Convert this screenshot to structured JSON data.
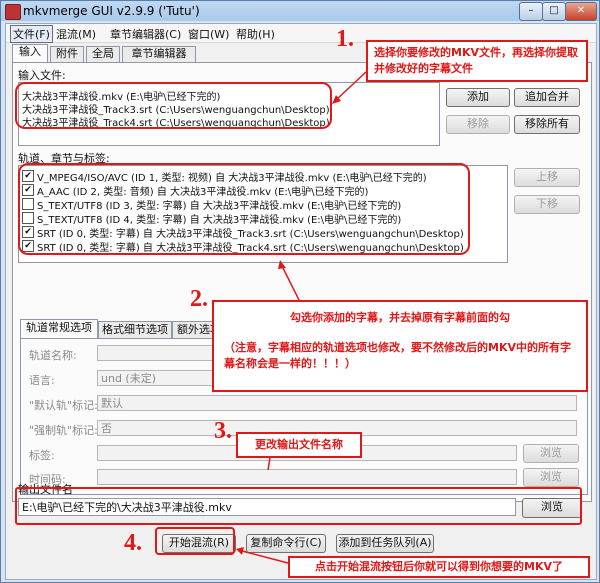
{
  "window": {
    "title": "mkvmerge GUI v2.9.9 ('Tutu')",
    "min": "–",
    "max": "□",
    "close": "✕"
  },
  "menu": [
    "文件(F)",
    "混流(M)",
    "章节编辑器(C)",
    "窗口(W)",
    "帮助(H)"
  ],
  "tabs": [
    "输入",
    "附件",
    "全局",
    "章节编辑器"
  ],
  "input_files": {
    "label": "输入文件:",
    "items": [
      "大决战3平津战役.mkv (E:\\电驴\\已经下完的)",
      "大决战3平津战役_Track3.srt (C:\\Users\\wenguangchun\\Desktop)",
      "大决战3平津战役_Track4.srt (C:\\Users\\wenguangchun\\Desktop)"
    ],
    "buttons": {
      "add": "添加",
      "append": "追加合并",
      "remove": "移除",
      "remove_all": "移除所有"
    }
  },
  "tracks": {
    "label": "轨道、章节与标签:",
    "items": [
      {
        "checked": true,
        "text": "V_MPEG4/ISO/AVC (ID 1, 类型: 视频) 自 大决战3平津战役.mkv (E:\\电驴\\已经下完的)"
      },
      {
        "checked": true,
        "text": "A_AAC (ID 2, 类型: 音频) 自 大决战3平津战役.mkv (E:\\电驴\\已经下完的)"
      },
      {
        "checked": false,
        "text": "S_TEXT/UTF8 (ID 3, 类型: 字幕) 自 大决战3平津战役.mkv (E:\\电驴\\已经下完的)"
      },
      {
        "checked": false,
        "text": "S_TEXT/UTF8 (ID 4, 类型: 字幕) 自 大决战3平津战役.mkv (E:\\电驴\\已经下完的)"
      },
      {
        "checked": true,
        "text": "SRT (ID 0, 类型: 字幕) 自 大决战3平津战役_Track3.srt (C:\\Users\\wenguangchun\\Desktop)"
      },
      {
        "checked": true,
        "text": "SRT (ID 0, 类型: 字幕) 自 大决战3平津战役_Track4.srt (C:\\Users\\wenguangchun\\Desktop)"
      }
    ],
    "up": "上移",
    "down": "下移"
  },
  "track_options": {
    "tabs": [
      "轨道常规选项",
      "格式细节选项",
      "额外选项"
    ],
    "track_name_label": "轨道名称:",
    "language_label": "语言:",
    "language_value": "und (未定)",
    "default_label": "\"默认轨\"标记:",
    "default_value": "默认",
    "forced_label": "\"强制轨\"标记:",
    "forced_value": "否",
    "tags_label": "标签:",
    "timecodes_label": "时间码:",
    "browse": "浏览"
  },
  "output": {
    "label": "输出文件名",
    "value": "E:\\电驴\\已经下完的\\大决战3平津战役.mkv",
    "browse": "浏览"
  },
  "bottom_buttons": {
    "start": "开始混流(R)",
    "copy": "复制命令行(C)",
    "queue": "添加到任务队列(A)"
  },
  "annotations": {
    "n1": "1.",
    "t1": "选择你要修改的MKV文件，再选择你提取并修改好的字幕文件",
    "n2": "2.",
    "t2a": "勾选你添加的字幕，并去掉原有字幕前面的勾",
    "t2b": "（注意，字幕相应的轨道选项也修改，要不然修改后的MKV中的所有字幕名称会是一样的！！！）",
    "n3": "3.",
    "t3": "更改输出文件名称",
    "n4": "4.",
    "t4": "点击开始混流按钮后你就可以得到你想要的MKV了"
  },
  "colors": {
    "accent": "#e01818",
    "title_bg": "#a9c9ea",
    "panel_bg": "#fbfbfb"
  }
}
